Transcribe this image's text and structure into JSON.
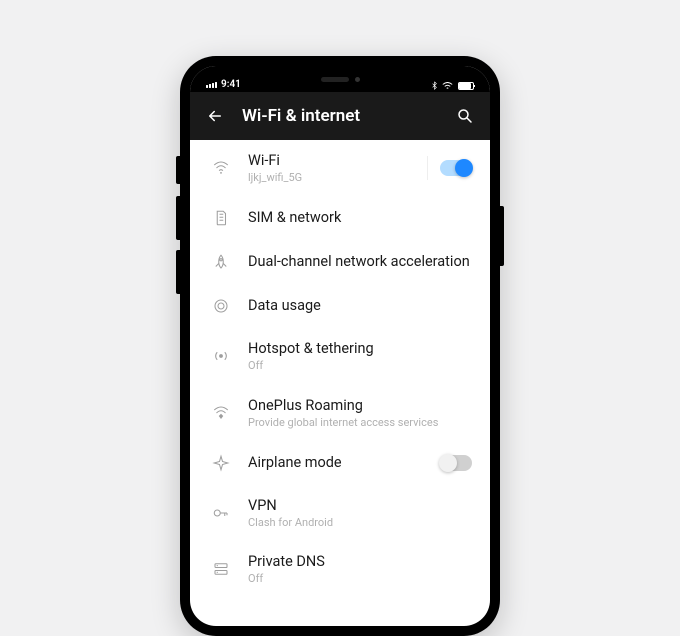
{
  "status": {
    "time": "9:41"
  },
  "appbar": {
    "title": "Wi-Fi & internet"
  },
  "rows": {
    "wifi": {
      "label": "Wi-Fi",
      "sub": "ljkj_wifi_5G",
      "toggle": true
    },
    "sim": {
      "label": "SIM & network"
    },
    "dual": {
      "label": "Dual-channel network acceleration"
    },
    "data": {
      "label": "Data usage"
    },
    "hotspot": {
      "label": "Hotspot & tethering",
      "sub": "Off"
    },
    "roaming": {
      "label": "OnePlus Roaming",
      "sub": "Provide global internet access services"
    },
    "airplane": {
      "label": "Airplane mode",
      "toggle": false
    },
    "vpn": {
      "label": "VPN",
      "sub": "Clash for Android"
    },
    "dns": {
      "label": "Private DNS",
      "sub": "Off"
    }
  }
}
